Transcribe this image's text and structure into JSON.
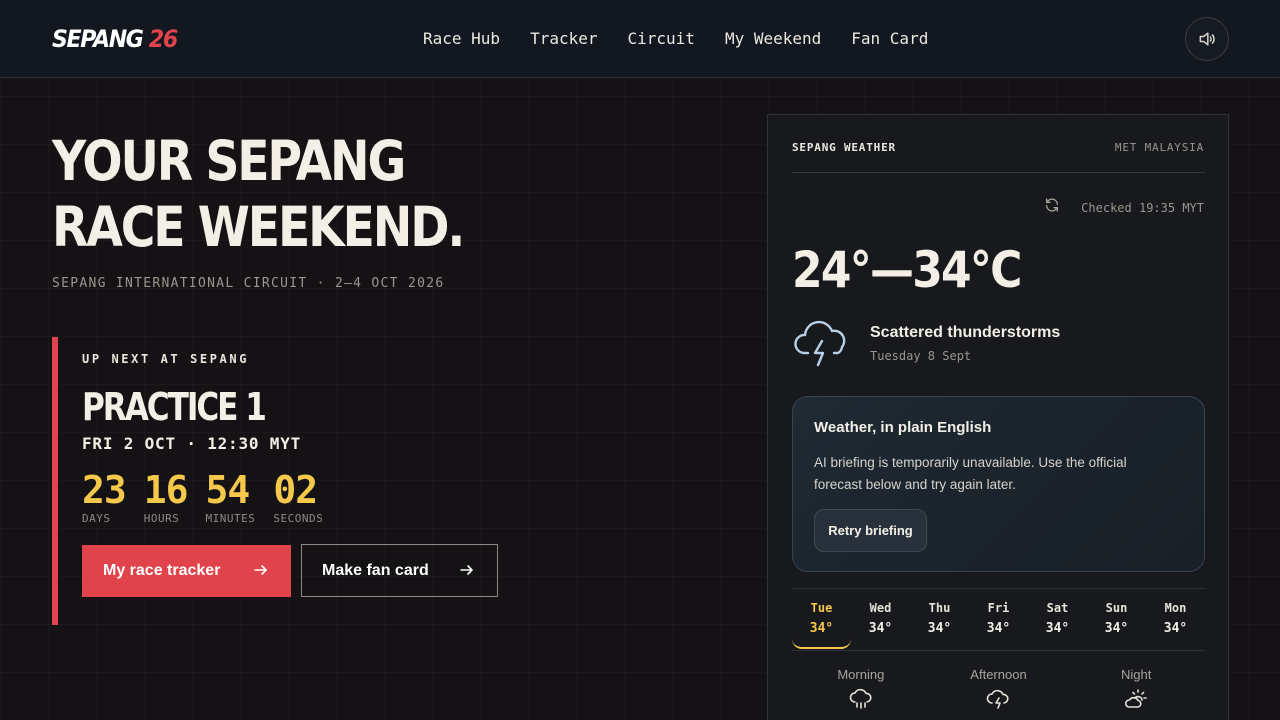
{
  "nav": {
    "logo_main": "SEPANG",
    "logo_year": "26",
    "links": [
      "Race Hub",
      "Tracker",
      "Circuit",
      "My Weekend",
      "Fan Card"
    ],
    "sound_icon": "speaker-icon"
  },
  "hero": {
    "title_line1": "YOUR SEPANG",
    "title_line2": "RACE WEEKEND.",
    "subtitle": "SEPANG INTERNATIONAL CIRCUIT · 2–4 OCT 2026"
  },
  "up_next": {
    "label": "UP NEXT AT SEPANG",
    "session": "PRACTICE 1",
    "time": "FRI 2 OCT · 12:30 MYT",
    "countdown": [
      {
        "value": "23",
        "label": "DAYS"
      },
      {
        "value": "16",
        "label": "HOURS"
      },
      {
        "value": "54",
        "label": "MINUTES"
      },
      {
        "value": "02",
        "label": "SECONDS"
      }
    ],
    "primary_button": "My race tracker",
    "secondary_button": "Make fan card"
  },
  "weather": {
    "title": "SEPANG WEATHER",
    "source": "MET MALAYSIA",
    "checked": "Checked 19:35 MYT",
    "temp_range": "24°—34°C",
    "condition": "Scattered thunderstorms",
    "date": "Tuesday 8 Sept",
    "briefing": {
      "title": "Weather, in plain English",
      "text": "AI briefing is temporarily unavailable. Use the official forecast below and try again later.",
      "button": "Retry briefing"
    },
    "days": [
      {
        "name": "Tue",
        "temp": "34°",
        "active": true
      },
      {
        "name": "Wed",
        "temp": "34°",
        "active": false
      },
      {
        "name": "Thu",
        "temp": "34°",
        "active": false
      },
      {
        "name": "Fri",
        "temp": "34°",
        "active": false
      },
      {
        "name": "Sat",
        "temp": "34°",
        "active": false
      },
      {
        "name": "Sun",
        "temp": "34°",
        "active": false
      },
      {
        "name": "Mon",
        "temp": "34°",
        "active": false
      }
    ],
    "periods": [
      {
        "name": "Morning",
        "icon": "rain-cloud-icon"
      },
      {
        "name": "Afternoon",
        "icon": "storm-cloud-icon"
      },
      {
        "name": "Night",
        "icon": "partly-cloudy-night-icon"
      }
    ]
  },
  "colors": {
    "accent_red": "#e0434b",
    "accent_yellow": "#f5c84b",
    "background": "#141215"
  }
}
